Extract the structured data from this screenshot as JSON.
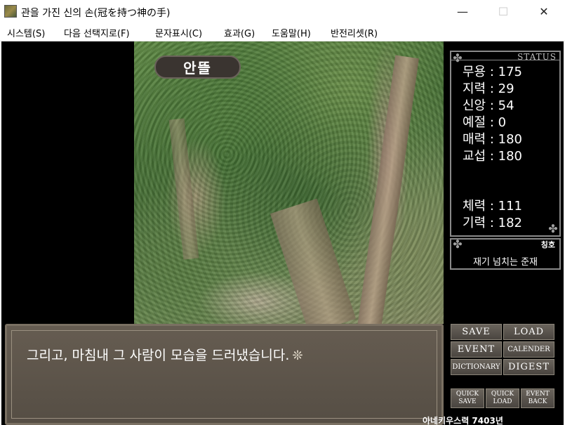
{
  "window": {
    "title": "관을 가진 신의 손(冠を持つ神の手)",
    "minimize": "—",
    "maximize": "☐",
    "close": "✕"
  },
  "menu": [
    "시스템(S)",
    "다음 선택지로(F)",
    "문자표시(C)",
    "효과(G)",
    "도움말(H)",
    "반전리셋(R)"
  ],
  "scene": {
    "speaker": "안뜰",
    "dialog": "그리고, 마침내 그 사람이 모습을 드러냈습니다.",
    "advance_icon": "❊"
  },
  "status": {
    "header": "STATUS",
    "stats": [
      "무용 : 175",
      "지력 : 29",
      "신앙 : 54",
      "예절 : 0",
      "매력 : 180",
      "교섭 : 180"
    ],
    "vitals": [
      "체력 : 111",
      "기력 : 182"
    ]
  },
  "honor": {
    "label": "칭호",
    "value": "재기 넘치는 준재"
  },
  "buttons": {
    "save": "SAVE",
    "load": "LOAD",
    "event": "EVENT",
    "calender": "CALENDER",
    "dictionary": "DICTIONARY",
    "digest": "DIGEST",
    "quick_save": "QUICK SAVE",
    "quick_load": "QUICK LOAD",
    "event_back": "EVENT BACK"
  },
  "calendar": "아네키우스력 7403년"
}
